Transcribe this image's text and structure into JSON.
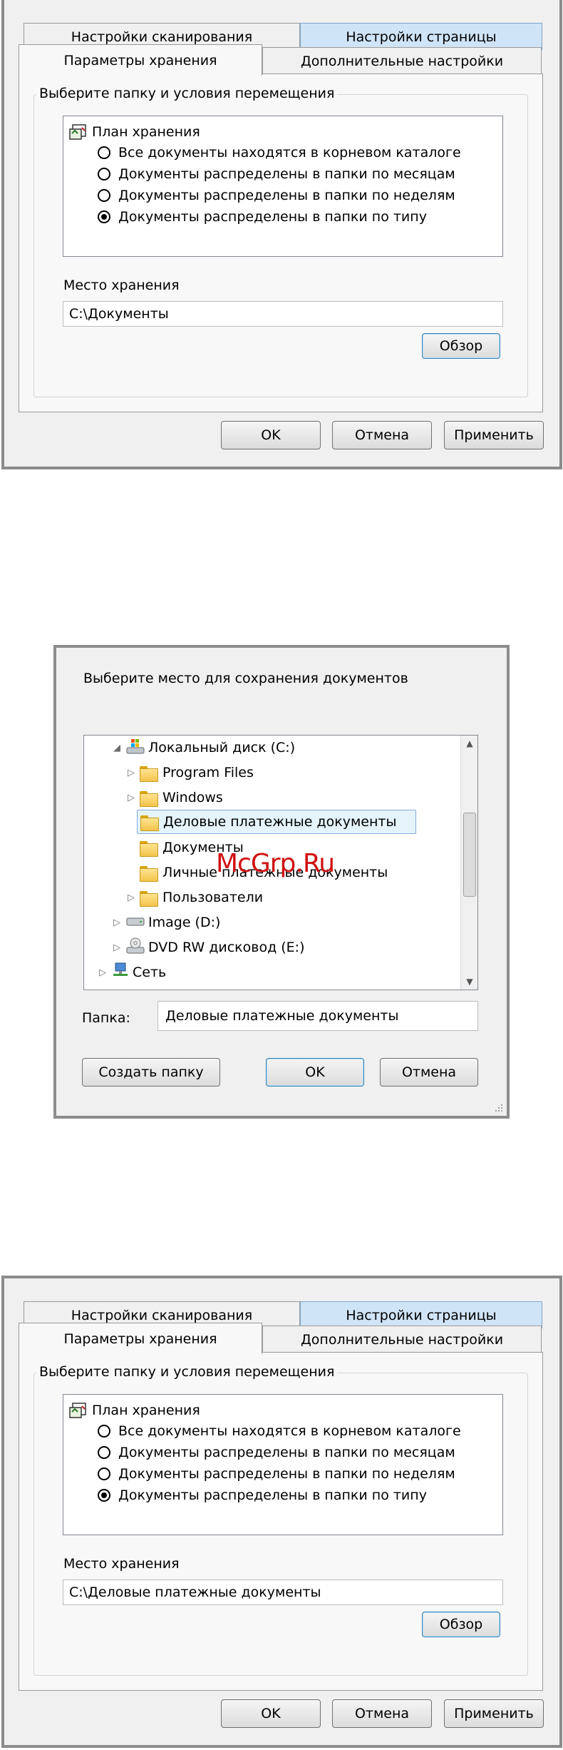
{
  "tabs": {
    "scan": "Настройки сканирования",
    "page": "Настройки страницы",
    "storage": "Параметры хранения",
    "advanced": "Дополнительные настройки"
  },
  "group": {
    "title": "Выберите папку и условия перемещения",
    "plan_title": "План хранения",
    "options": [
      "Все документы находятся в корневом каталоге",
      "Документы распределены в папки по месяцам",
      "Документы распределены в папки по неделям",
      "Документы распределены в папки по типу"
    ],
    "selected_option": 3,
    "location_label": "Место хранения",
    "browse_label": "Обзор"
  },
  "dialog1": {
    "location_value": "C:\\Документы"
  },
  "dialog3": {
    "location_value": "C:\\Деловые платежные документы"
  },
  "buttons": {
    "ok": "OK",
    "cancel": "Отмена",
    "apply": "Применить"
  },
  "browse": {
    "prompt": "Выберите место для сохранения документов",
    "tree": [
      {
        "label": "Локальный диск (C:)",
        "icon": "drive-windows-icon",
        "expanded": true
      },
      {
        "label": "Program Files",
        "icon": "folder-icon",
        "has_children": true
      },
      {
        "label": "Windows",
        "icon": "folder-icon",
        "has_children": true
      },
      {
        "label": "Деловые платежные документы",
        "icon": "folder-icon",
        "selected": true
      },
      {
        "label": "Документы",
        "icon": "folder-icon"
      },
      {
        "label": "Личные платежные документы",
        "icon": "folder-icon"
      },
      {
        "label": "Пользователи",
        "icon": "folder-icon",
        "has_children": true
      },
      {
        "label": "Image (D:)",
        "icon": "drive-icon",
        "has_children": true
      },
      {
        "label": "DVD RW дисковод (E:)",
        "icon": "dvd-drive-icon",
        "has_children": true
      },
      {
        "label": "Сеть",
        "icon": "network-icon",
        "has_children": true
      }
    ],
    "folder_label": "Папка:",
    "folder_value": "Деловые платежные документы",
    "new_folder": "Создать папку",
    "ok": "OK",
    "cancel": "Отмена"
  },
  "watermark": "McGrp.Ru",
  "colors": {
    "tab_highlight": "#cfe4f7",
    "selection_border": "#84acdd",
    "watermark": "#d01010"
  }
}
